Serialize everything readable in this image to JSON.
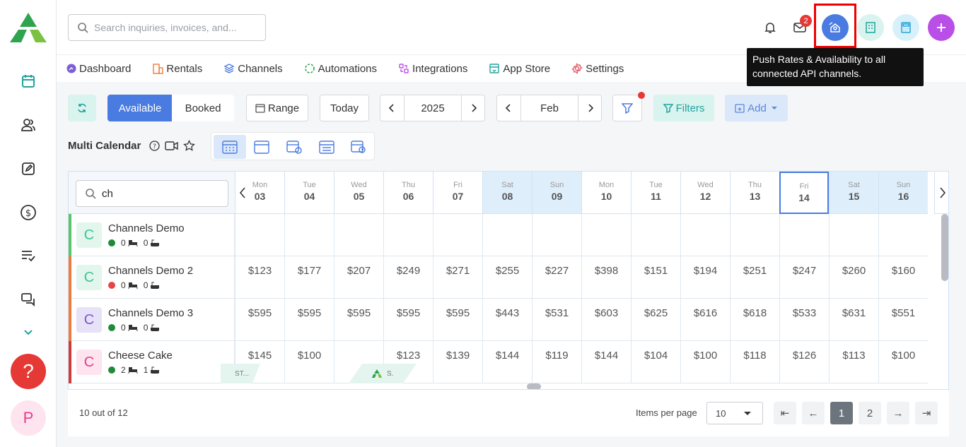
{
  "header": {
    "search_placeholder": "Search inquiries, invoices, and...",
    "mail_badge": "2",
    "tooltip": "Push Rates & Availability to all connected API channels."
  },
  "nav": {
    "items": [
      {
        "label": "Dashboard",
        "icon": "dashboard-icon"
      },
      {
        "label": "Rentals",
        "icon": "rentals-icon"
      },
      {
        "label": "Channels",
        "icon": "channels-icon"
      },
      {
        "label": "Automations",
        "icon": "automations-icon"
      },
      {
        "label": "Integrations",
        "icon": "integrations-icon"
      },
      {
        "label": "App Store",
        "icon": "app-store-icon"
      },
      {
        "label": "Settings",
        "icon": "settings-icon"
      }
    ]
  },
  "toolbar": {
    "available": "Available",
    "booked": "Booked",
    "range": "Range",
    "today": "Today",
    "year": "2025",
    "month": "Feb",
    "filters": "Filters",
    "add": "Add"
  },
  "calendar": {
    "title": "Multi Calendar",
    "search_value": "ch",
    "days": [
      {
        "name": "Mon",
        "num": "03"
      },
      {
        "name": "Tue",
        "num": "04"
      },
      {
        "name": "Wed",
        "num": "05"
      },
      {
        "name": "Thu",
        "num": "06"
      },
      {
        "name": "Fri",
        "num": "07"
      },
      {
        "name": "Sat",
        "num": "08"
      },
      {
        "name": "Sun",
        "num": "09"
      },
      {
        "name": "Mon",
        "num": "10"
      },
      {
        "name": "Tue",
        "num": "11"
      },
      {
        "name": "Wed",
        "num": "12"
      },
      {
        "name": "Thu",
        "num": "13"
      },
      {
        "name": "Fri",
        "num": "14"
      },
      {
        "name": "Sat",
        "num": "15"
      },
      {
        "name": "Sun",
        "num": "16"
      }
    ],
    "rentals": [
      {
        "name": "Channels Demo",
        "letter": "C",
        "dot": "#1f8a3a",
        "bar": "#5cc46a",
        "avatar_bg": "#e2f6ee",
        "avatar_fg": "#3cc49a",
        "beds": "0",
        "baths": "0",
        "prices": [
          "",
          "",
          "",
          "",
          "",
          "",
          "",
          "",
          "",
          "",
          "",
          "",
          "",
          ""
        ]
      },
      {
        "name": "Channels Demo 2",
        "letter": "C",
        "dot": "#e54545",
        "bar": "#f07a3a",
        "avatar_bg": "#e2f6ee",
        "avatar_fg": "#3cc49a",
        "beds": "0",
        "baths": "0",
        "prices": [
          "$123",
          "$177",
          "$207",
          "$249",
          "$271",
          "$255",
          "$227",
          "$398",
          "$151",
          "$194",
          "$251",
          "$247",
          "$260",
          "$160"
        ]
      },
      {
        "name": "Channels Demo 3",
        "letter": "C",
        "dot": "#1f8a3a",
        "bar": "#f07a3a",
        "avatar_bg": "#e8e2f8",
        "avatar_fg": "#7a5ad0",
        "beds": "0",
        "baths": "0",
        "prices": [
          "$595",
          "$595",
          "$595",
          "$595",
          "$595",
          "$443",
          "$531",
          "$603",
          "$625",
          "$616",
          "$618",
          "$533",
          "$631",
          "$551"
        ]
      },
      {
        "name": "Cheese Cake",
        "letter": "C",
        "dot": "#1f8a3a",
        "bar": "#d23a3a",
        "avatar_bg": "#fde4ef",
        "avatar_fg": "#e0408a",
        "beds": "2",
        "baths": "1",
        "prices": [
          "$145",
          "$100",
          "",
          "$123",
          "$139",
          "$144",
          "$119",
          "$144",
          "$104",
          "$100",
          "$118",
          "$126",
          "$113",
          "$100"
        ]
      }
    ]
  },
  "footer": {
    "count": "10 out of 12",
    "per_page_label": "Items per page",
    "per_page": "10",
    "pages": [
      "1",
      "2"
    ]
  },
  "sidebar": {
    "user_initial": "P",
    "help": "?"
  }
}
